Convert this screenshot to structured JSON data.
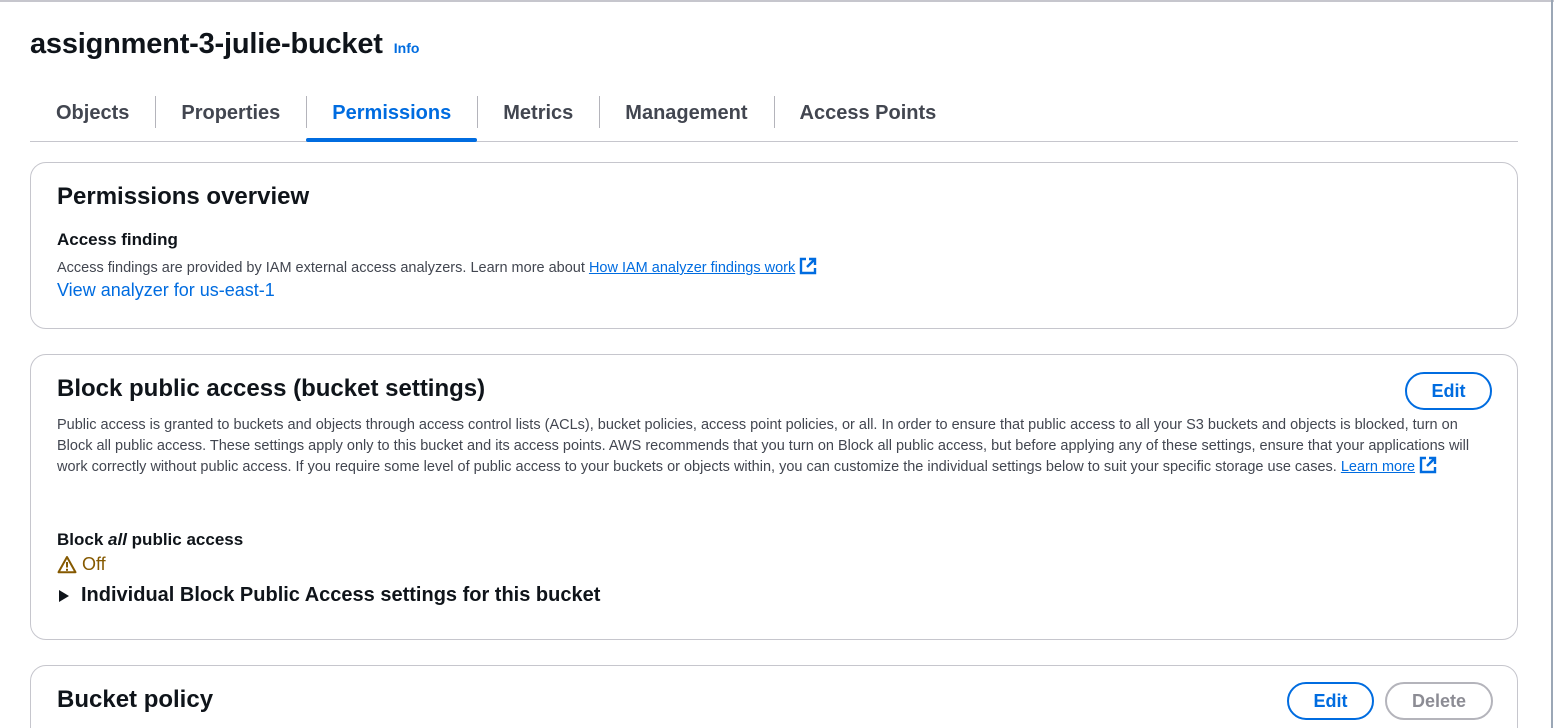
{
  "bucket": {
    "name": "assignment-3-julie-bucket",
    "info_label": "Info"
  },
  "tabs": [
    {
      "label": "Objects",
      "active": false
    },
    {
      "label": "Properties",
      "active": false
    },
    {
      "label": "Permissions",
      "active": true
    },
    {
      "label": "Metrics",
      "active": false
    },
    {
      "label": "Management",
      "active": false
    },
    {
      "label": "Access Points",
      "active": false
    }
  ],
  "permissions_overview": {
    "title": "Permissions overview",
    "access_finding_label": "Access finding",
    "description": "Access findings are provided by IAM external access analyzers. Learn more about",
    "description_link": "How IAM analyzer findings work",
    "analyzer_link": "View analyzer for us-east-1"
  },
  "block_public_access": {
    "title": "Block public access (bucket settings)",
    "edit_label": "Edit",
    "description": "Public access is granted to buckets and objects through access control lists (ACLs), bucket policies, access point policies, or all. In order to ensure that public access to all your S3 buckets and objects is blocked, turn on Block all public access. These settings apply only to this bucket and its access points. AWS recommends that you turn on Block all public access, but before applying any of these settings, ensure that your applications will work correctly without public access. If you require some level of public access to your buckets or objects within, you can customize the individual settings below to suit your specific storage use cases.",
    "learn_more": "Learn more",
    "block_all_prefix": "Block",
    "block_all_emph": "all",
    "block_all_suffix": "public access",
    "status_value": "Off",
    "status_icon": "warning-icon",
    "status_color": "#855900",
    "expander_label": "Individual Block Public Access settings for this bucket"
  },
  "bucket_policy": {
    "title": "Bucket policy",
    "edit_label": "Edit",
    "delete_label": "Delete"
  },
  "colors": {
    "accent": "#006ce0",
    "text": "#0f141a",
    "secondary_text": "#424650",
    "border": "#c6c6cd"
  }
}
